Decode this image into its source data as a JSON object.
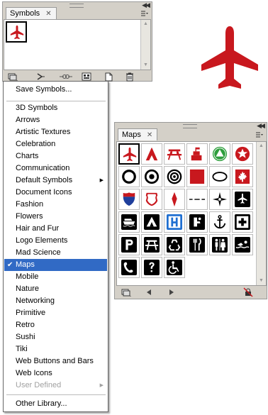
{
  "symbols_panel": {
    "tab_label": "Symbols",
    "close_glyph": "✕",
    "bottom_icons": [
      "symbol-libraries-menu-icon",
      "place-symbol-instance-icon",
      "break-link-icon",
      "symbol-options-icon",
      "new-symbol-icon",
      "delete-symbol-icon"
    ]
  },
  "preview": {
    "icon": "airplane-icon",
    "color": "#c8181e"
  },
  "menu": {
    "items": [
      {
        "label": "Save Symbols...",
        "state": "normal"
      },
      {
        "label": "3D Symbols",
        "state": "normal"
      },
      {
        "label": "Arrows",
        "state": "normal"
      },
      {
        "label": "Artistic Textures",
        "state": "normal"
      },
      {
        "label": "Celebration",
        "state": "normal"
      },
      {
        "label": "Charts",
        "state": "normal"
      },
      {
        "label": "Communication",
        "state": "normal"
      },
      {
        "label": "Default Symbols",
        "state": "submenu"
      },
      {
        "label": "Document Icons",
        "state": "normal"
      },
      {
        "label": "Fashion",
        "state": "normal"
      },
      {
        "label": "Flowers",
        "state": "normal"
      },
      {
        "label": "Hair and Fur",
        "state": "normal"
      },
      {
        "label": "Logo Elements",
        "state": "normal"
      },
      {
        "label": "Mad Science",
        "state": "normal"
      },
      {
        "label": "Maps",
        "state": "checked"
      },
      {
        "label": "Mobile",
        "state": "normal"
      },
      {
        "label": "Nature",
        "state": "normal"
      },
      {
        "label": "Networking",
        "state": "normal"
      },
      {
        "label": "Primitive",
        "state": "normal"
      },
      {
        "label": "Retro",
        "state": "normal"
      },
      {
        "label": "Sushi",
        "state": "normal"
      },
      {
        "label": "Tiki",
        "state": "normal"
      },
      {
        "label": "Web Buttons and Bars",
        "state": "normal"
      },
      {
        "label": "Web Icons",
        "state": "normal"
      },
      {
        "label": "User Defined",
        "state": "disabled-submenu"
      },
      {
        "label": "Other Library...",
        "state": "normal"
      }
    ],
    "checkmark": "✔",
    "submenu_arrow": "▶",
    "accent": "#316ac5"
  },
  "maps_panel": {
    "tab_label": "Maps",
    "close_glyph": "✕",
    "symbols": [
      "airplane-red-icon",
      "tent-red-icon",
      "picnic-table-red-icon",
      "camp-flag-red-icon",
      "triangle-circle-green-icon",
      "star-circle-red-icon",
      "ring-icon",
      "target-dot-icon",
      "double-ring-icon",
      "red-square-icon",
      "ellipse-icon",
      "maple-leaf-icon",
      "interstate-shield-icon",
      "us-route-shield-icon",
      "red-marker-icon",
      "dashed-line-icon",
      "compass-icon",
      "airport-icon",
      "ferry-icon",
      "camping-icon",
      "hospital-icon",
      "drinking-water-icon",
      "marina-anchor-icon",
      "first-aid-icon",
      "parking-icon",
      "picnic-icon",
      "recycling-icon",
      "restaurant-icon",
      "restrooms-icon",
      "swimming-icon",
      "telephone-icon",
      "information-icon",
      "accessible-icon"
    ],
    "bottom_icons": [
      "symbol-libraries-menu-icon",
      "previous-library-icon",
      "next-library-icon",
      "locked-icon"
    ],
    "colors": {
      "red": "#c8181e",
      "green": "#2d9e3c",
      "blue": "#1f6fd1"
    }
  }
}
